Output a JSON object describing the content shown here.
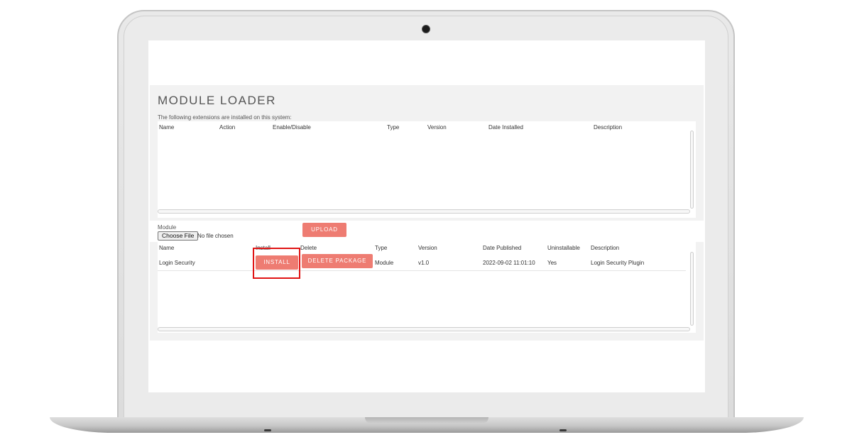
{
  "module_loader": {
    "title": "MODULE LOADER",
    "subtitle": "The following extensions are installed on this system:",
    "installed_table": {
      "columns": [
        "Name",
        "Action",
        "Enable/Disable",
        "Type",
        "Version",
        "Date Installed",
        "Description"
      ],
      "rows": []
    },
    "upload": {
      "module_label": "Module",
      "choose_file_label": "Choose File",
      "file_status": "No file chosen",
      "upload_label": "UPLOAD"
    },
    "packages_table": {
      "columns": [
        "Name",
        "Install",
        "Delete",
        "Type",
        "Version",
        "Date Published",
        "Uninstallable",
        "Description"
      ],
      "rows": [
        {
          "name": "Login Security",
          "install_label": "INSTALL",
          "delete_label": "DELETE PACKAGE",
          "type": "Module",
          "version": "v1.0",
          "date_published": "2022-09-02 11:01:10",
          "uninstallable": "Yes",
          "description": "Login Security Plugin"
        }
      ]
    }
  },
  "colors": {
    "accent_button": "#ee7c72",
    "highlight_box": "#e01414",
    "panel_bg": "#f2f2f2"
  }
}
